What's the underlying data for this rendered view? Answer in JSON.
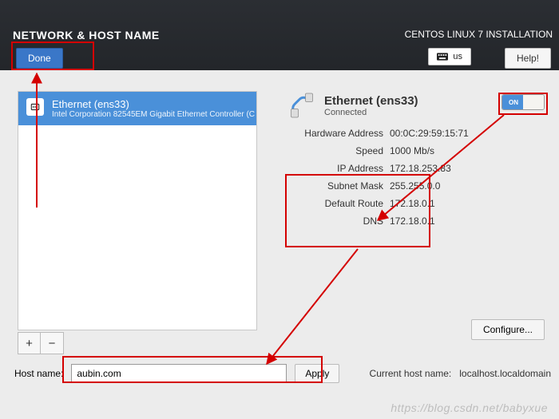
{
  "header": {
    "title": "NETWORK & HOST NAME",
    "subtitle": "CENTOS LINUX 7 INSTALLATION",
    "done_label": "Done",
    "help_label": "Help!",
    "keyboard_layout": "us"
  },
  "nic_list": {
    "items": [
      {
        "name": "Ethernet (ens33)",
        "desc": "Intel Corporation 82545EM Gigabit Ethernet Controller (C"
      }
    ],
    "add_label": "+",
    "remove_label": "−"
  },
  "detail": {
    "title": "Ethernet (ens33)",
    "status": "Connected",
    "switch_on_label": "ON",
    "kv": {
      "hwaddr_k": "Hardware Address",
      "hwaddr_v": "00:0C:29:59:15:71",
      "speed_k": "Speed",
      "speed_v": "1000 Mb/s",
      "ip_k": "IP Address",
      "ip_v": "172.18.253.83",
      "mask_k": "Subnet Mask",
      "mask_v": "255.255.0.0",
      "gw_k": "Default Route",
      "gw_v": "172.18.0.1",
      "dns_k": "DNS",
      "dns_v": "172.18.0.1"
    },
    "configure_label": "Configure..."
  },
  "hostname": {
    "label": "Host name:",
    "value": "aubin.com",
    "apply_label": "Apply",
    "current_label": "Current host name:",
    "current_value": "localhost.localdomain"
  },
  "watermark": "https://blog.csdn.net/babyxue"
}
